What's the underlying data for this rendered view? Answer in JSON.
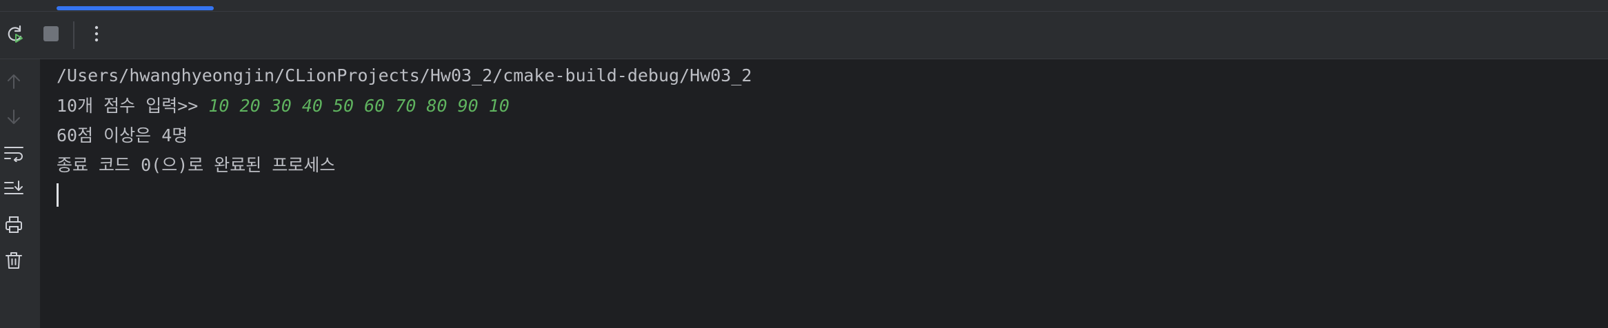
{
  "toolbar": {
    "rerun_icon": "rerun-icon",
    "stop_icon": "stop-icon",
    "more_icon": "more-vertical-icon"
  },
  "gutter": {
    "icons": [
      "arrow-up-icon",
      "arrow-down-icon",
      "soft-wrap-icon",
      "scroll-to-end-icon",
      "print-icon",
      "trash-icon"
    ]
  },
  "console": {
    "path_line": "/Users/hwanghyeongjin/CLionProjects/Hw03_2/cmake-build-debug/Hw03_2",
    "prompt_text": "10개 점수 입력>> ",
    "input_text": "10 20 30 40 50 60 70 80 90 10",
    "result_line": "60점 이상은 4명",
    "exit_line": "종료 코드 0(으)로 완료된 프로세스"
  },
  "colors": {
    "background": "#1e1f22",
    "panel": "#2b2d30",
    "text": "#bcbec4",
    "input": "#5fb35f",
    "accent": "#3574f0"
  }
}
